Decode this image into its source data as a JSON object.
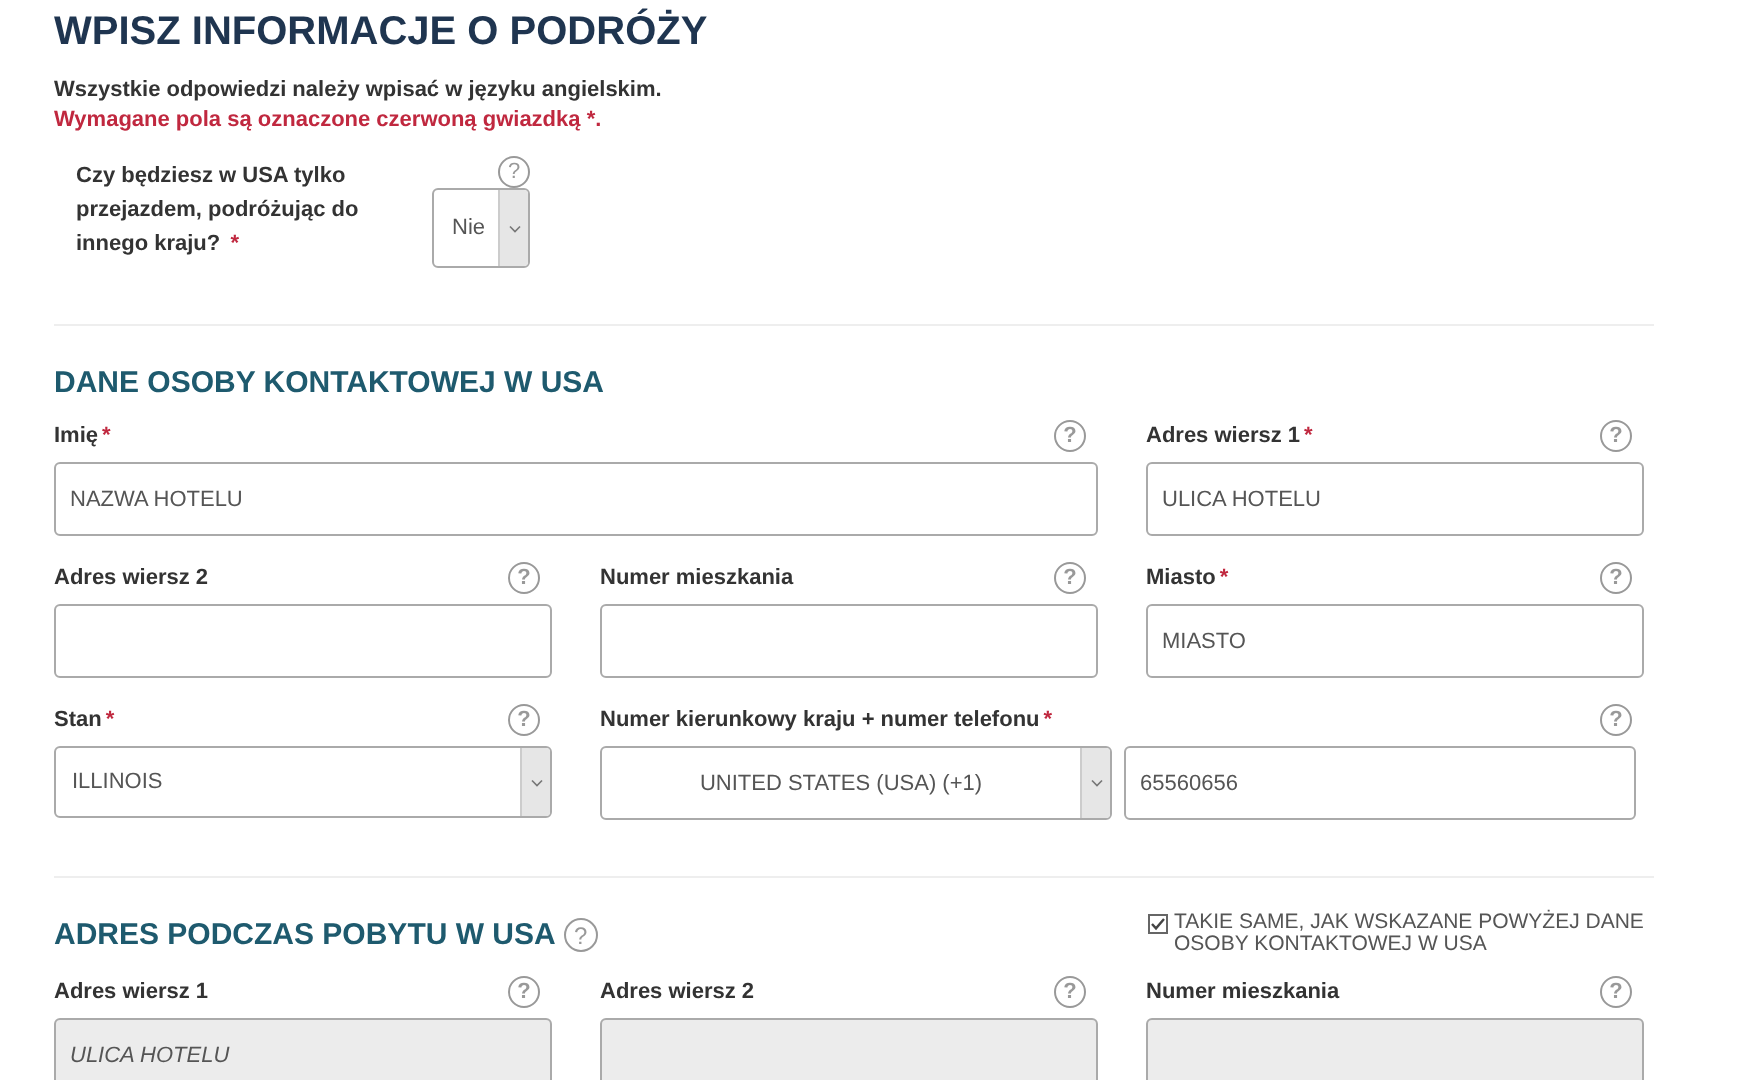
{
  "title": "WPISZ INFORMACJE O PODRÓŻY",
  "intro": "Wszystkie odpowiedzi należy wpisać w języku angielskim.",
  "required_note": "Wymagane pola są oznaczone czerwoną gwiazdką *.",
  "transit_question": {
    "label": "Czy będziesz w USA tylko przejazdem, podróżując do innego kraju?",
    "required_mark": "*",
    "help": "?",
    "value": "Nie"
  },
  "sections": [
    {
      "title": "DANE OSOBY KONTAKTOWEJ W USA",
      "fields": [
        {
          "kind": "text",
          "label": "Imię",
          "required_mark": "*",
          "help": "?",
          "value": "NAZWA HOTELU",
          "wide": true,
          "disabled": false
        },
        {
          "kind": "text",
          "label": "Adres wiersz 1",
          "required_mark": "*",
          "help": "?",
          "value": "ULICA HOTELU",
          "wide": false,
          "disabled": false
        },
        {
          "kind": "text",
          "label": "Adres wiersz 2",
          "help": "?",
          "wide": false,
          "disabled": false
        },
        {
          "kind": "text",
          "label": "Numer mieszkania",
          "help": "?",
          "wide": false,
          "disabled": false
        },
        {
          "kind": "text",
          "label": "Miasto",
          "required_mark": "*",
          "help": "?",
          "value": "MIASTO",
          "wide": false,
          "disabled": false
        },
        {
          "kind": "select",
          "label": "Stan",
          "required_mark": "*",
          "help": "?",
          "value": "ILLINOIS",
          "wide": false,
          "disabled": false
        },
        {
          "kind": "phone",
          "label": "Numer kierunkowy kraju + numer telefonu",
          "required_mark": "*",
          "help": "?",
          "country": "UNITED STATES (USA) (+1)",
          "value": "65560656",
          "wide": true,
          "disabled": false
        }
      ]
    },
    {
      "title": "ADRES PODCZAS POBYTU W USA",
      "help": "?",
      "same_as": {
        "label": "TAKIE SAME, JAK WSKAZANE POWYŻEJ DANE OSOBY KONTAKTOWEJ W USA",
        "checked": true
      },
      "fields": [
        {
          "kind": "text",
          "label": "Adres wiersz 1",
          "help": "?",
          "value": "ULICA HOTELU",
          "wide": false,
          "disabled": true
        },
        {
          "kind": "text",
          "label": "Adres wiersz 2",
          "help": "?",
          "wide": false,
          "disabled": true
        },
        {
          "kind": "text",
          "label": "Numer mieszkania",
          "help": "?",
          "wide": false,
          "disabled": true
        }
      ]
    }
  ]
}
